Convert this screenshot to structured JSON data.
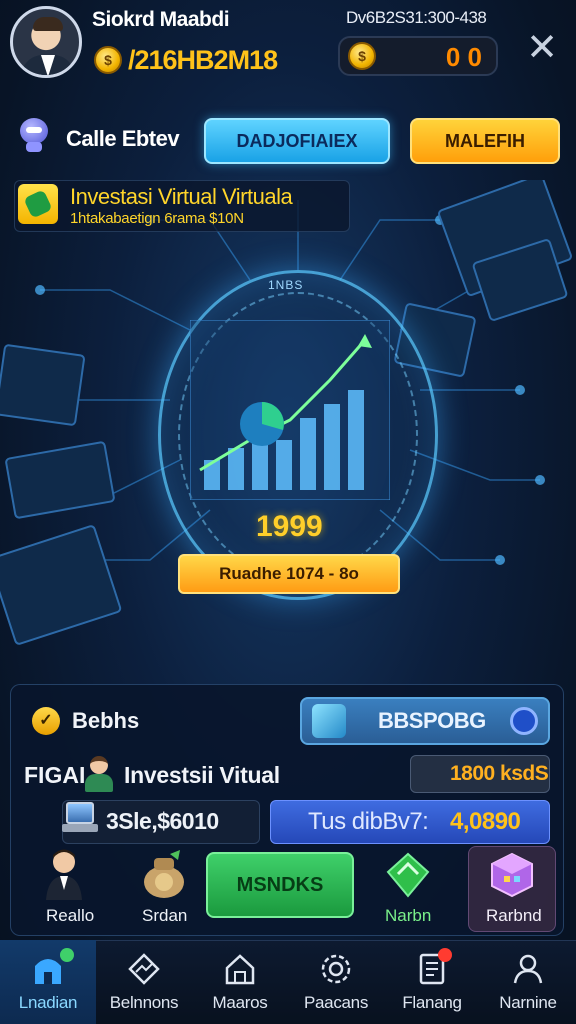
{
  "header": {
    "username": "Siokrd Maabdi",
    "balance": "/216HB2M18",
    "top_stat": "Dv6B2S31:300-438",
    "coin_count": "0 0",
    "coin_symbol": "$",
    "close_symbol": "✕"
  },
  "actions_row": {
    "call_label": "Calle Ebtev",
    "blue_button": "DADJOFIAIEX",
    "orange_button": "MALEFIH"
  },
  "invest_banner": {
    "title": "Investasi Virtual Virtuala",
    "subtitle": "1htakabaetign 6rama $10N"
  },
  "hologram": {
    "ring_label": "1NBS",
    "score": "1999",
    "reach_button": "Ruadhe 1074 - 8o"
  },
  "panel": {
    "details_label": "Bebhs",
    "boost_button": "BBSPOBG",
    "fiat_label": "FIGAI",
    "invest_virtual": "Investsii Vitual",
    "price": "1800 ksdS",
    "stat": "3Sle,$6010",
    "total_label": "Tus dibBv7:",
    "total_value": "4,0890"
  },
  "action_tiles": [
    {
      "label": "Reallo"
    },
    {
      "label": "Srdan"
    },
    {
      "label": "MSNDKS"
    },
    {
      "label": "Narbn"
    },
    {
      "label": "Rarbnd"
    }
  ],
  "nav": [
    {
      "label": "Lnadian",
      "icon": "home-icon"
    },
    {
      "label": "Belnnons",
      "icon": "chart-icon"
    },
    {
      "label": "Maaros",
      "icon": "house-icon"
    },
    {
      "label": "Paacans",
      "icon": "gear-icon"
    },
    {
      "label": "Flanang",
      "icon": "document-icon"
    },
    {
      "label": "Narnine",
      "icon": "users-icon"
    }
  ],
  "colors": {
    "accent_gold": "#ffc21a",
    "accent_blue": "#19a2e6",
    "accent_green": "#1b9a3e"
  }
}
